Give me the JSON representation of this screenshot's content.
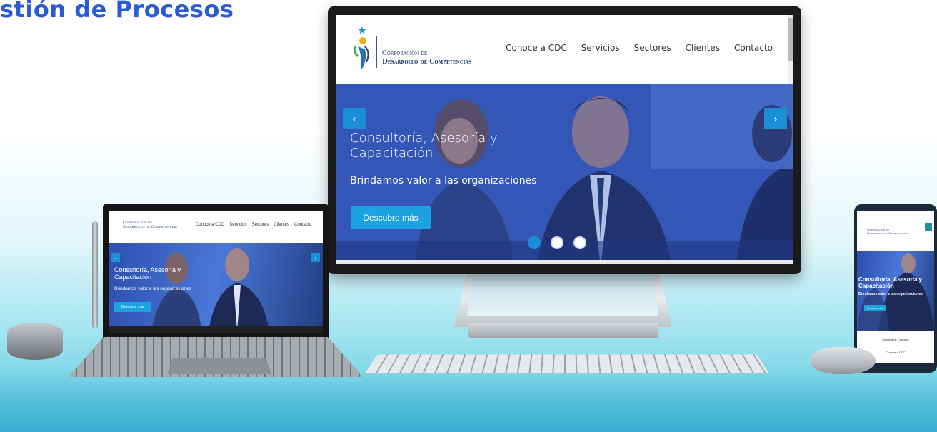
{
  "page": {
    "heading": "stión de Procesos"
  },
  "site": {
    "logo": {
      "line1": "Corporación de",
      "line2": "Desarrollo de Competencias"
    },
    "nav": [
      "Conoce a CDC",
      "Servicios",
      "Sectores",
      "Clientes",
      "Contacto"
    ],
    "hero": {
      "title": "Consultoría, Asesoría y Capacitación",
      "subtitle": "Brindamos valor a las organizaciones",
      "button": "Descubre más",
      "prev_icon": "chevron-left",
      "next_icon": "chevron-right"
    },
    "colors": {
      "accent": "#1aa3e0",
      "arrow": "#1a8fd8",
      "brand": "#1f3d7a"
    }
  },
  "tablet": {
    "nav": [
      "Conoce a CDC",
      "Servicios",
      "Sectores",
      "Clientes",
      "Contacto"
    ],
    "hero_title": "Consultoría, Asesoría y Capacitación",
    "hero_subtitle": "Brindamos valor a las organizaciones",
    "button": "Descubre más"
  },
  "phone": {
    "hero_title": "Consultoría, Asesoría y Capacitación",
    "hero_subtitle": "Brindamos valor a las organizaciones",
    "button": "Descubre más",
    "footer_item_1": "Solicitud de Contacto",
    "footer_item_2": "Conoce a CDC"
  }
}
